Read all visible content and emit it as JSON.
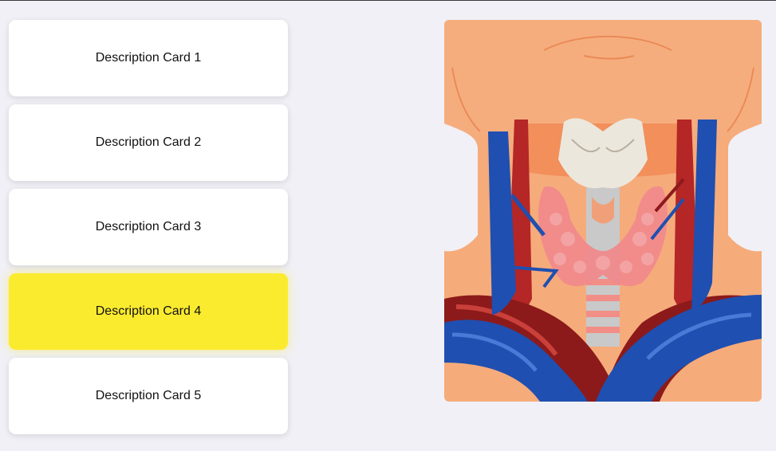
{
  "cards": [
    {
      "label": "Description Card 1",
      "active": false
    },
    {
      "label": "Description Card 2",
      "active": false
    },
    {
      "label": "Description Card 3",
      "active": false
    },
    {
      "label": "Description Card 4",
      "active": true
    },
    {
      "label": "Description Card 5",
      "active": false
    }
  ],
  "colors": {
    "background": "#f0f0f6",
    "card": "#ffffff",
    "active_card": "#fbeb2f",
    "skin": "#f6ab7b",
    "vein": "#1f4fb0",
    "artery": "#b52626",
    "thyroid": "#f08a8c"
  },
  "illustration": {
    "icon": "neck-thyroid-anatomy-icon"
  }
}
